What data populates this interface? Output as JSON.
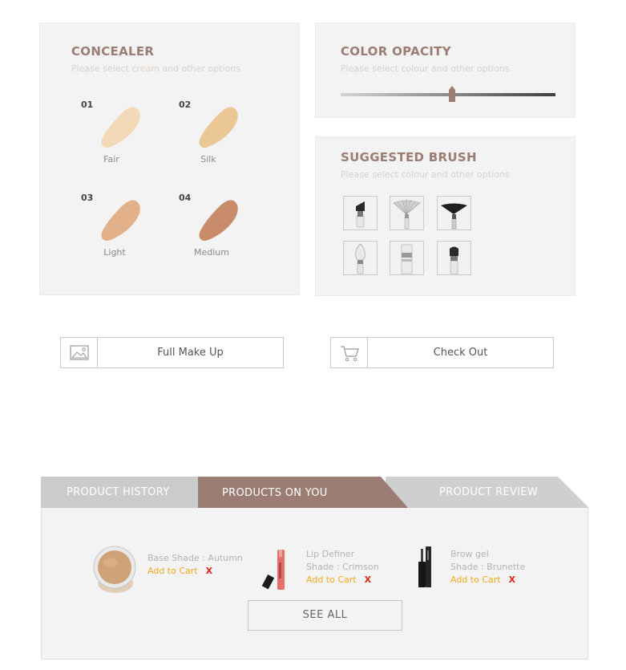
{
  "concealer": {
    "title": "CONCEALER",
    "subtitle_prefix": "Please select ",
    "subtitle_highlight": "cream",
    "subtitle_suffix": " and other options",
    "shades": [
      {
        "number": "01",
        "name": "Fair",
        "color": "#f3d9b8"
      },
      {
        "number": "02",
        "name": "Silk",
        "color": "#ebc795"
      },
      {
        "number": "03",
        "name": "Light",
        "color": "#e3b189"
      },
      {
        "number": "04",
        "name": "Medium",
        "color": "#c98c6a"
      }
    ]
  },
  "opacity": {
    "title": "COLOR OPACITY",
    "subtitle": "Please select colour and other options",
    "value": 0.52,
    "thumb_color": "#9b7d74"
  },
  "brush": {
    "title": "SUGGESTED BRUSH",
    "subtitle": "Please select colour and other options",
    "items": [
      "angled-brush-icon",
      "fan-brush-icon",
      "black-fan-brush-icon",
      "round-brush-icon",
      "flat-brush-icon",
      "stipple-brush-icon"
    ]
  },
  "actions": {
    "full_makeup": "Full Make Up",
    "checkout": "Check Out"
  },
  "tabs": {
    "history": "PRODUCT HISTORY",
    "on_you": "PRODUCTS ON YOU",
    "review": "PRODUCT REVIEW"
  },
  "products": [
    {
      "line1": "Base Shade : Autumn",
      "cart": "Add to Cart",
      "remove": "X"
    },
    {
      "line1": "Lip Definer",
      "line2": "Shade : Crimson",
      "cart": "Add to Cart",
      "remove": "X"
    },
    {
      "line1": "Brow gel",
      "line2": "Shade : Brunette",
      "cart": "Add to Cart",
      "remove": "X"
    }
  ],
  "see_all": "SEE ALL",
  "colors": {
    "accent": "#9b7d74",
    "tab_inactive": "#c9c9c9",
    "cart": "#f2a91c",
    "remove": "#e0251b"
  }
}
